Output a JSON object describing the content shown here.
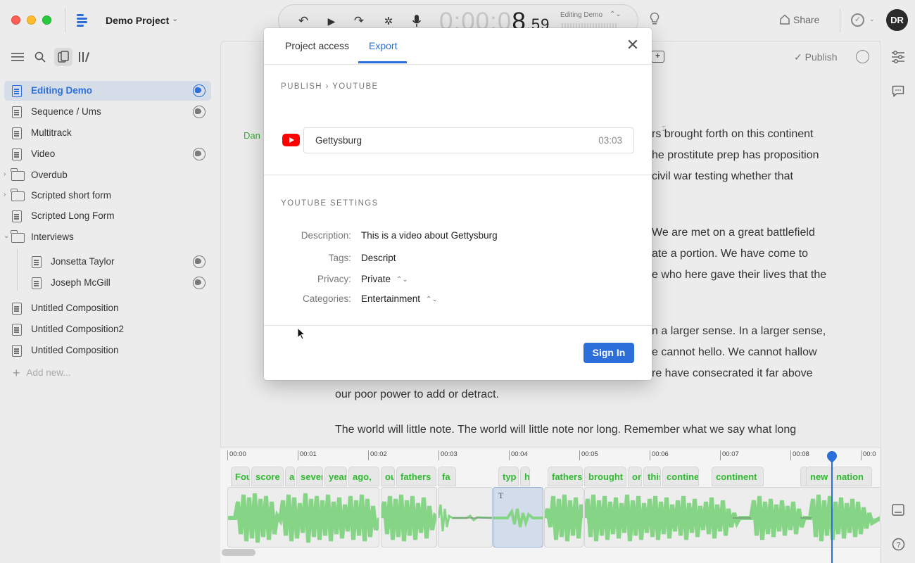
{
  "titlebar": {
    "project_name": "Demo Project",
    "timecode_dim": "0:00:0",
    "timecode_main": "8",
    "timecode_frac": ".59",
    "composition_label": "Editing Demo",
    "share_label": "Share",
    "avatar_initials": "DR"
  },
  "sidebar": {
    "items": [
      {
        "label": "Editing Demo",
        "type": "doc",
        "published": true,
        "selected": true
      },
      {
        "label": "Sequence / Ums",
        "type": "doc",
        "published": true
      },
      {
        "label": "Multitrack",
        "type": "doc",
        "published": false
      },
      {
        "label": "Video",
        "type": "doc",
        "published": true
      },
      {
        "label": "Overdub",
        "type": "folder",
        "expanded": false
      },
      {
        "label": "Scripted short form",
        "type": "folder",
        "expanded": false
      },
      {
        "label": "Scripted Long Form",
        "type": "doc",
        "published": false
      },
      {
        "label": "Interviews",
        "type": "folder",
        "expanded": true
      },
      {
        "label": "Jonsetta Taylor",
        "type": "doc",
        "published": true,
        "child": true
      },
      {
        "label": "Joseph McGill",
        "type": "doc",
        "published": true,
        "child": true
      },
      {
        "label": "Untitled Composition",
        "type": "doc",
        "published": false
      },
      {
        "label": "Untitled Composition2",
        "type": "doc",
        "published": false
      },
      {
        "label": "Untitled Composition",
        "type": "doc",
        "published": false
      }
    ],
    "add_new": "Add new..."
  },
  "editor": {
    "publish_label": "Publish",
    "speaker": "Dan",
    "paragraphs": [
      [
        "rs brought forth on this continent",
        "he prostitute prep has proposition",
        "civil war testing whether that"
      ],
      [
        "We are met on a great battlefield",
        "ate a portion. We have come to",
        "e who here gave their lives that the"
      ],
      [
        "n a larger sense. In a larger sense,",
        "e cannot hello. We cannot hallow",
        "re have consecrated it far above"
      ],
      [
        "our poor power to add or detract."
      ],
      [
        "The world will little note. The world will little note nor long. Remember what we say what long"
      ]
    ]
  },
  "timeline": {
    "ticks": [
      "00:00",
      "00:01",
      "00:02",
      "00:03",
      "00:04",
      "00:05",
      "00:06",
      "00:07",
      "00:08",
      "00:0"
    ],
    "words": [
      "Fou",
      "score",
      "a",
      "seven",
      "years",
      "ago,",
      "our",
      "fathers",
      "fa",
      "typ",
      "h",
      "fathers",
      "brought",
      "on",
      "this",
      "continent",
      "continent",
      "",
      "new",
      "nation"
    ],
    "selected_clip_icon": "T"
  },
  "modal": {
    "tabs": [
      "Project access",
      "Export"
    ],
    "active_tab": "Export",
    "breadcrumb": "PUBLISH  ›  YOUTUBE",
    "video_title": "Gettysburg",
    "duration": "03:03",
    "settings_heading": "YOUTUBE SETTINGS",
    "fields": [
      {
        "label": "Description:",
        "value": "This is a video about Gettysburg"
      },
      {
        "label": "Tags:",
        "value": "Descript"
      },
      {
        "label": "Privacy:",
        "value": "Private"
      },
      {
        "label": "Categories:",
        "value": "Entertainment"
      }
    ],
    "sign_in_label": "Sign In"
  },
  "colors": {
    "accent": "#2c6fdb",
    "youtube_red": "#ff0000",
    "word_green": "#2fbb2f",
    "waveform_green": "#86d486"
  }
}
